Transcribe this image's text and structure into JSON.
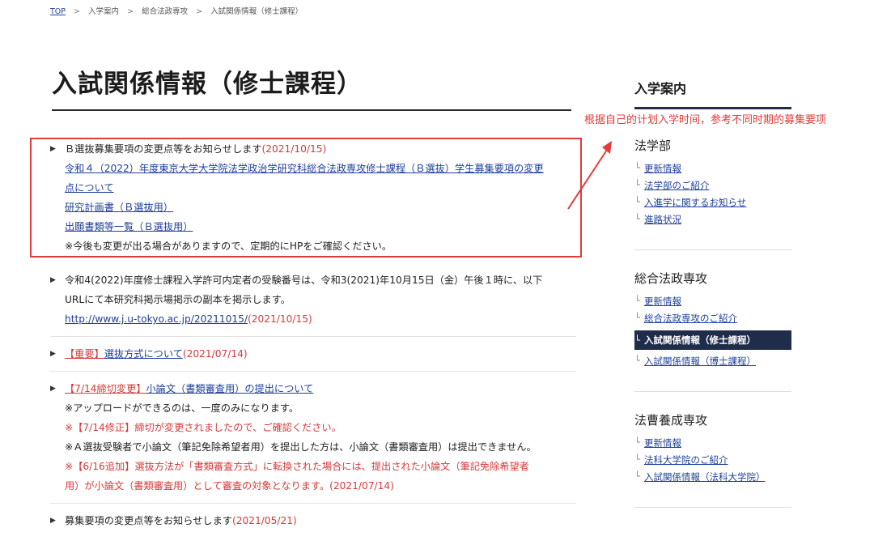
{
  "breadcrumb": {
    "items": [
      "TOP",
      "入学案内",
      "総合法政専攻",
      "入試関係情報（修士課程）"
    ],
    "separator": ">"
  },
  "page_title": "入試関係情報（修士課程）",
  "annotation": "根据自己的计划入学时间，参考不同时期的募集要项",
  "news": {
    "item1": {
      "title": "Ｂ選抜募集要項の変更点等をお知らせします",
      "date": "(2021/10/15)",
      "link1_a": "令和４（2022）年度東京大学大学院法学政治学研究科総合法政専攻修士課程（Ｂ選抜）学生募集要項の変更",
      "link1_b": "点について",
      "link2": "研究計画書（Ｂ選抜用）",
      "link3": "出願書類等一覧（Ｂ選抜用）",
      "note": "※今後も変更が出る場合がありますので、定期的にHPをご確認ください。"
    },
    "item2": {
      "line1": "令和4(2022)年度修士課程入学許可内定者の受験番号は、令和3(2021)年10月15日（金）午後１時に、以下",
      "line2": "URLにて本研究科掲示場掲示の副本を掲示します。",
      "url": "http://www.j.u-tokyo.ac.jp/20211015/",
      "date": "(2021/10/15)"
    },
    "item3": {
      "tag": "【重要】",
      "link": "選抜方式について",
      "date": "(2021/07/14)"
    },
    "item4": {
      "tag": "【7/14締切変更】",
      "link": "小論文（書類審査用）の提出について",
      "note1": "※アップロードができるのは、一度のみになります。",
      "note2": "※【7/14修正】締切が変更されましたので、ご確認ください。",
      "note3": "※Ａ選抜受験者で小論文（筆記免除希望者用）を提出した方は、小論文（書類審査用）は提出できません。",
      "note4_red": "※【6/16追加】選抜方法が「書類審査方式」に転換された場合には、提出された小論文（筆記免除希望者",
      "note4b_red": "用）が小論文（書類審査用）として審査の対象となります。",
      "note4_date": "(2021/07/14)"
    },
    "item5": {
      "title": "募集要項の変更点等をお知らせします",
      "date": "(2021/05/21)"
    }
  },
  "sidebar": {
    "heading": "入学案内",
    "sections": [
      {
        "title": "法学部",
        "items": [
          "更新情報",
          "法学部のご紹介",
          "入進学に関するお知らせ",
          "進路状況"
        ]
      },
      {
        "title": "総合法政専攻",
        "items": [
          "更新情報",
          "総合法政専攻のご紹介",
          "入試関係情報（修士課程）",
          "入試関係情報（博士課程）"
        ],
        "active_index": 2
      },
      {
        "title": "法曹養成専攻",
        "items": [
          "更新情報",
          "法科大学院のご紹介",
          "入試関係情報（法科大学院）"
        ]
      }
    ],
    "branch_mark": "└"
  },
  "colors": {
    "link": "#1f3f9a",
    "red": "#e23b3b",
    "navy": "#1f2c4a"
  }
}
